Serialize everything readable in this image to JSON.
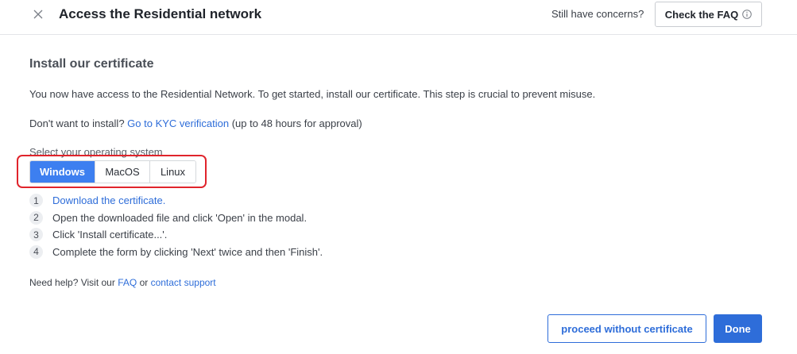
{
  "header": {
    "close_icon": "close-icon",
    "title": "Access the Residential network",
    "concerns_text": "Still have concerns?",
    "faq_button_label": "Check the FAQ",
    "faq_button_icon": "info-icon"
  },
  "content": {
    "section_title": "Install our certificate",
    "description": "You now have access to the Residential Network. To get started, install our certificate. This step is crucial to prevent misuse.",
    "kyc": {
      "prefix": "Don't want to install?",
      "link": "Go to KYC verification",
      "suffix": "(up to 48 hours for approval)"
    },
    "os_label": "Select your operating system",
    "os_options": [
      {
        "label": "Windows",
        "active": true
      },
      {
        "label": "MacOS",
        "active": false
      },
      {
        "label": "Linux",
        "active": false
      }
    ],
    "steps": [
      {
        "num": "1",
        "text": "Download the certificate.",
        "is_link": true
      },
      {
        "num": "2",
        "text": "Open the downloaded file and click 'Open' in the modal.",
        "is_link": false
      },
      {
        "num": "3",
        "text": "Click 'Install certificate...'.",
        "is_link": false
      },
      {
        "num": "4",
        "text": "Complete the form by clicking 'Next' twice and then 'Finish'.",
        "is_link": false
      }
    ],
    "help": {
      "prefix": "Need help? Visit our",
      "faq_link": "FAQ",
      "or": "or",
      "support_link": "contact support"
    }
  },
  "footer": {
    "proceed_label": "proceed without certificate",
    "done_label": "Done"
  },
  "colors": {
    "accent": "#2e6dd9",
    "active_tab": "#3d7ff0",
    "highlight": "#e0242c"
  }
}
